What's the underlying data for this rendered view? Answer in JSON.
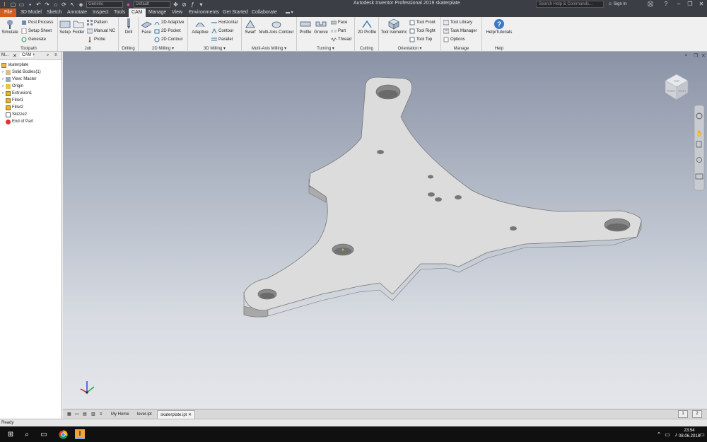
{
  "titlebar": {
    "title": "Autodesk Inventor Professional 2019    skaterplate",
    "material": "Generic",
    "appearance": "Default",
    "search_placeholder": "Search Help & Commands...",
    "signin": "Sign In"
  },
  "tabs": [
    "File",
    "3D Model",
    "Sketch",
    "Annotate",
    "Inspect",
    "Tools",
    "CAM",
    "Manage",
    "View",
    "Environments",
    "Get Started",
    "Collaborate"
  ],
  "active_tab": "CAM",
  "ribbon": {
    "toolpath": {
      "label": "Toolpath",
      "simulate": "Simulate",
      "post_process": "Post Process",
      "setup_sheet": "Setup Sheet",
      "generate": "Generate"
    },
    "job": {
      "label": "Job",
      "setup": "Setup",
      "folder": "Folder",
      "pattern": "Pattern",
      "manual_nc": "Manual NC",
      "probe": "Probe"
    },
    "drilling": {
      "label": "Drilling",
      "drill": "Drill"
    },
    "milling2d": {
      "label": "2D Milling",
      "face": "Face",
      "adaptive": "2D Adaptive",
      "pocket": "2D Pocket",
      "contour": "2D Contour"
    },
    "milling3d": {
      "label": "3D Milling",
      "adaptive": "Adaptive",
      "horizontal": "Horizontal",
      "contour": "Contour",
      "parallel": "Parallel"
    },
    "multiaxis": {
      "label": "Multi-Axis Milling",
      "swarf": "Swarf",
      "multi_axis_contour": "Multi-Axis Contour"
    },
    "turning": {
      "label": "Turning",
      "profile": "Profile",
      "groove": "Groove",
      "face": "Face",
      "part": "Part",
      "thread": "Thread"
    },
    "cutting": {
      "label": "Cutting",
      "profile2d": "2D Profile"
    },
    "orientation": {
      "label": "Orientation",
      "tool_isometric": "Tool Isometric",
      "tool_front": "Tool Front",
      "tool_right": "Tool Right",
      "tool_top": "Tool Top"
    },
    "manage": {
      "label": "Manage",
      "tool_library": "Tool Library",
      "task_manager": "Task Manager",
      "options": "Options"
    },
    "help": {
      "label": "Help",
      "help_tutorials": "Help/Tutorials"
    }
  },
  "browser": {
    "tab_model": "M...",
    "tab_cam": "CAM",
    "items": [
      {
        "label": "skaterplate",
        "icon": "part-icon",
        "indent": 0
      },
      {
        "label": "Solid Bodies(1)",
        "icon": "folder-icon",
        "indent": 1
      },
      {
        "label": "View: Master",
        "icon": "view-icon",
        "indent": 1
      },
      {
        "label": "Origin",
        "icon": "folder-icon",
        "indent": 1
      },
      {
        "label": "Extrusion1",
        "icon": "extrusion-icon",
        "indent": 1
      },
      {
        "label": "Fillet1",
        "icon": "fillet-icon",
        "indent": 1
      },
      {
        "label": "Fillet2",
        "icon": "fillet-icon",
        "indent": 1
      },
      {
        "label": "Skizze2",
        "icon": "sketch-icon",
        "indent": 1
      },
      {
        "label": "End of Part",
        "icon": "end-of-part-icon",
        "indent": 1
      }
    ]
  },
  "doc_tabs": [
    "My Home",
    "lever.ipt",
    "skaterplate.ipt"
  ],
  "active_doc": "skaterplate.ipt",
  "status": {
    "ready": "Ready",
    "page1": "1",
    "page2": "2"
  },
  "taskbar": {
    "time": "23:54",
    "date": "08.06.2018"
  },
  "viewcube": {
    "face_top": "TOP",
    "face_front": "FRONT",
    "face_right": "RIGHT"
  },
  "colors": {
    "file_tab": "#d35c1f",
    "titlebar": "#3b3f45",
    "part_top": "#dadada",
    "part_side": "#b4b4b4"
  }
}
